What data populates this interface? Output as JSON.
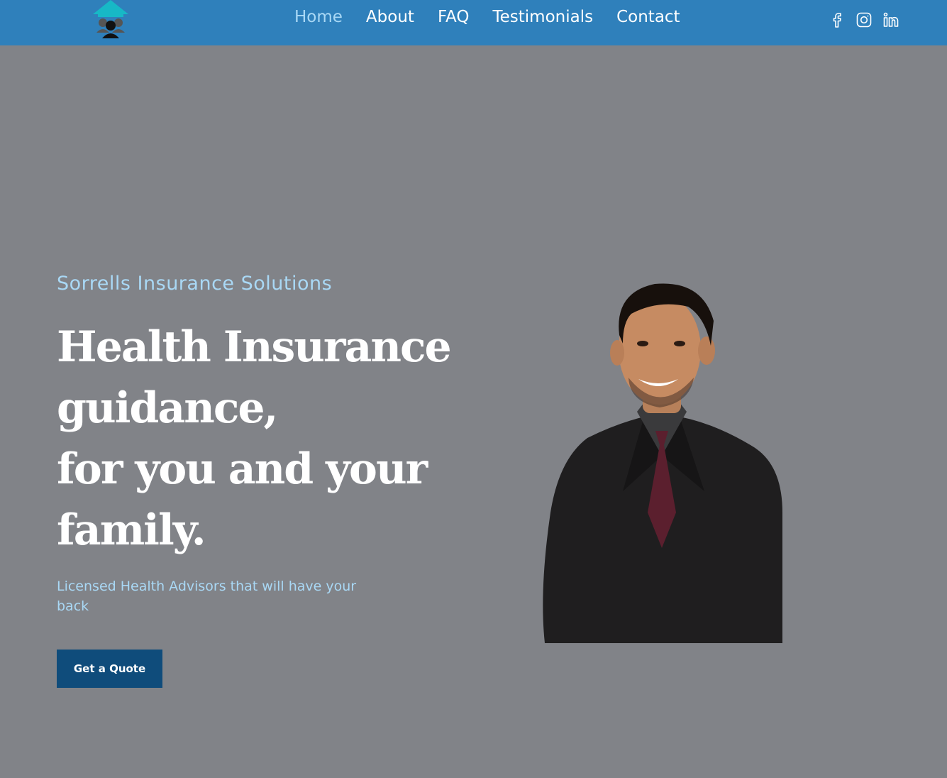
{
  "nav": {
    "links": [
      {
        "label": "Home",
        "active": true
      },
      {
        "label": "About",
        "active": false
      },
      {
        "label": "FAQ",
        "active": false
      },
      {
        "label": "Testimonials",
        "active": false
      },
      {
        "label": "Contact",
        "active": false
      }
    ],
    "social_icons": [
      "facebook-icon",
      "instagram-icon",
      "linkedin-icon"
    ]
  },
  "hero": {
    "brand": "Sorrells Insurance Solutions",
    "headline_lines": [
      "Health Insurance",
      "guidance,",
      "for you and your",
      "family."
    ],
    "subtext": "Licensed Health Advisors that will have your back",
    "cta_label": "Get a Quote"
  },
  "colors": {
    "navbar": "#2f80bb",
    "background": "#818388",
    "accent_text": "#a9d8f5",
    "button": "#0f4c7b",
    "logo_roof": "#17b8c6"
  }
}
